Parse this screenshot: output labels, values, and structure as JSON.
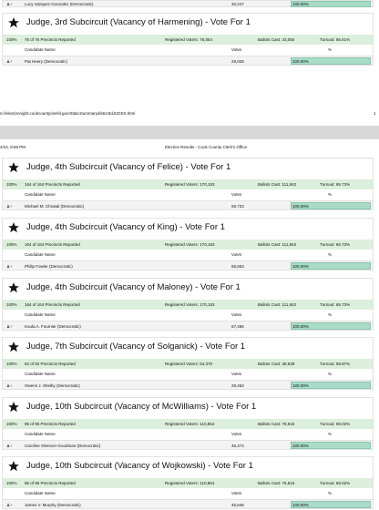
{
  "top_partial_row": {
    "name": "Lucy Vazquez-Gonzalez (Democratic)",
    "votes": "30,247",
    "pct": "100.00%"
  },
  "headers": {
    "candidate": "Candidate Name",
    "votes": "Votes",
    "pct": "%"
  },
  "contests": [
    {
      "title": "Judge, 3rd Subcircuit (Vacancy of Harmening) - Vote For 1",
      "pct": "100%",
      "reported": "76 of 76 Precincts Reported",
      "registered": "Registered Voters: 76,054",
      "ballots": "Ballots Cast: 43,055",
      "turnout": "Turnout: 56.61%",
      "candidate": "Pat Heery (Democratic)",
      "votes": "29,028",
      "cand_pct": "100.00%"
    },
    {
      "title": "Judge, 4th Subcircuit (Vacancy of Felice) - Vote For 1",
      "pct": "100%",
      "reported": "164 of 164 Precincts Reported",
      "registered": "Registered Voters: 170,153",
      "ballots": "Ballots Cast: 111,842",
      "turnout": "Turnout: 65.73%",
      "candidate": "Michael M. Chvatal (Democratic)",
      "votes": "68,733",
      "cand_pct": "100.00%"
    },
    {
      "title": "Judge, 4th Subcircuit (Vacancy of King) - Vote For 1",
      "pct": "100%",
      "reported": "164 of 164 Precincts Reported",
      "registered": "Registered Voters: 170,153",
      "ballots": "Ballots Cast: 111,842",
      "turnout": "Turnout: 65.73%",
      "candidate": "Philip Fowler (Democratic)",
      "votes": "68,653",
      "cand_pct": "100.00%"
    },
    {
      "title": "Judge, 4th Subcircuit (Vacancy of Maloney) - Vote For 1",
      "pct": "100%",
      "reported": "164 of 164 Precincts Reported",
      "registered": "Registered Voters: 170,153",
      "ballots": "Ballots Cast: 111,842",
      "turnout": "Turnout: 65.73%",
      "candidate": "Koula A. Fournier (Democratic)",
      "votes": "67,486",
      "cand_pct": "100.00%"
    },
    {
      "title": "Judge, 7th Subcircuit (Vacancy of Solganick) - Vote For 1",
      "pct": "100%",
      "reported": "62 of 62 Precincts Reported",
      "registered": "Registered Voters: 64,370",
      "ballots": "Ballots Cast: 38,539",
      "turnout": "Turnout: 59.87%",
      "candidate": "Owens J. Shelby (Democratic)",
      "votes": "28,462",
      "cand_pct": "100.00%"
    },
    {
      "title": "Judge, 10th Subcircuit (Vacancy of McWilliams) - Vote For 1",
      "pct": "100%",
      "reported": "95 of 95 Precincts Reported",
      "registered": "Registered Voters: 110,864",
      "ballots": "Ballots Cast: 76,515",
      "turnout": "Turnout: 69.02%",
      "candidate": "Caroline Glennon-Goodman (Democratic)",
      "votes": "45,474",
      "cand_pct": "100.00%"
    },
    {
      "title": "Judge, 10th Subcircuit (Vacancy of Wojkowski) - Vote For 1",
      "pct": "100%",
      "reported": "95 of 95 Precincts Reported",
      "registered": "Registered Voters: 110,864",
      "ballots": "Ballots Cast: 76,515",
      "turnout": "Turnout: 69.02%",
      "candidate": "James V. Murphy (Democratic)",
      "votes": "45,646",
      "cand_pct": "100.00%"
    }
  ],
  "footer": {
    "url": "s://electionnight.cookcountyclerkil.gov/StaticSummarydistrictIdJUDSS.html",
    "page": "1"
  },
  "page_header": {
    "date": "4/24, 8:59 PM",
    "title": "Election Results - Cook County Clerk's Office"
  }
}
